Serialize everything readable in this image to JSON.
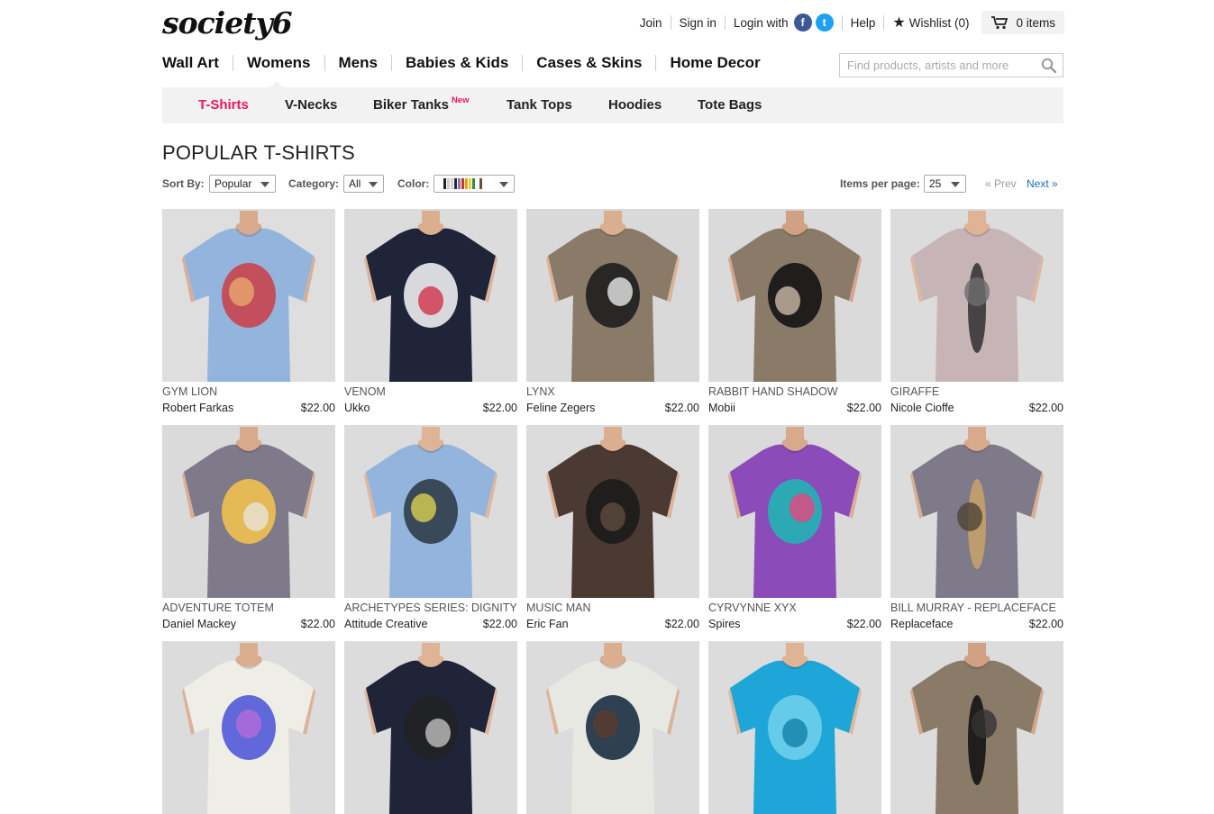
{
  "brand": {
    "logo": "society6"
  },
  "top_links": {
    "join": "Join",
    "sign_in": "Sign in",
    "login_with": "Login with",
    "facebook_glyph": "f",
    "twitter_glyph": "t",
    "help": "Help",
    "wishlist": "Wishlist (0)",
    "cart": "0 items"
  },
  "main_nav": [
    "Wall Art",
    "Womens",
    "Mens",
    "Babies & Kids",
    "Cases & Skins",
    "Home Decor"
  ],
  "search": {
    "placeholder": "Find products, artists and more"
  },
  "sub_nav": {
    "items": [
      "T-Shirts",
      "V-Necks",
      "Biker Tanks",
      "Tank Tops",
      "Hoodies",
      "Tote Bags"
    ],
    "active": "T-Shirts",
    "new_badge": "New"
  },
  "page_title": "POPULAR T-SHIRTS",
  "filters": {
    "sort_by_label": "Sort By:",
    "sort_by_value": "Popular",
    "category_label": "Category:",
    "category_value": "All",
    "color_label": "Color:",
    "color_swatches": [
      "#ffffff",
      "#222222",
      "#cfcfcf",
      "#e0c9c9",
      "#1c2a4e",
      "#8d6fb2",
      "#c0392b",
      "#f39c12",
      "#e8d43a",
      "#2e8b57",
      "#ffffff",
      "#6b4e3d"
    ],
    "items_per_page_label": "Items per page:",
    "items_per_page_value": "25",
    "prev": "« Prev",
    "next": "Next »"
  },
  "colors": {
    "accent_pink": "#e8175d",
    "link_blue": "#1a6fb5"
  },
  "products": [
    {
      "title": "GYM LION",
      "artist": "Robert Farkas",
      "price": "$22.00",
      "shirt": "#93b4dc",
      "bg": "#dedede",
      "skin": "#d8a98b",
      "art": "#c9414b",
      "art2": "#e7a86b"
    },
    {
      "title": "VENOM",
      "artist": "Ukko",
      "price": "$22.00",
      "shirt": "#1f2438",
      "bg": "#dcdcdc",
      "skin": "#dcae90",
      "art": "#f3f3f3",
      "art2": "#d2324a"
    },
    {
      "title": "LYNX",
      "artist": "Feline Zegers",
      "price": "$22.00",
      "shirt": "#8a7a68",
      "bg": "#d9d9d9",
      "skin": "#dcae90",
      "art": "#1b1b1b",
      "art2": "#e8e8e8"
    },
    {
      "title": "RABBIT HAND SHADOW",
      "artist": "Mobii",
      "price": "$22.00",
      "shirt": "#8a7a68",
      "bg": "#dadada",
      "skin": "#d2a184",
      "art": "#111111",
      "art2": "#c9b9a6"
    },
    {
      "title": "GIRAFFE",
      "artist": "Nicole Cioffe",
      "price": "$22.00",
      "shirt": "#c7b4b6",
      "bg": "#dcdcdc",
      "skin": "#dfb396",
      "art": "#333333",
      "art2": "#6e6e6e"
    },
    {
      "title": "ADVENTURE TOTEM",
      "artist": "Daniel Mackey",
      "price": "$22.00",
      "shirt": "#7e7a8a",
      "bg": "#dadada",
      "skin": "#d8a98b",
      "art": "#f2c14f",
      "art2": "#e9e3d8"
    },
    {
      "title": "ARCHETYPES SERIES: DIGNITY",
      "artist": "Attitude Creative",
      "price": "$22.00",
      "shirt": "#93b4dc",
      "bg": "#dcdcdc",
      "skin": "#dfb396",
      "art": "#2d3a44",
      "art2": "#d9d14f"
    },
    {
      "title": "MUSIC MAN",
      "artist": "Eric Fan",
      "price": "$22.00",
      "shirt": "#4a3a32",
      "bg": "#dcdcdc",
      "skin": "#dcae90",
      "art": "#1a1a1a",
      "art2": "#5e4a3f"
    },
    {
      "title": "CYRVYNNE XYX",
      "artist": "Spires",
      "price": "$22.00",
      "shirt": "#8b4bb8",
      "bg": "#dadada",
      "skin": "#d8a98b",
      "art": "#1fb6b3",
      "art2": "#e8457d"
    },
    {
      "title": "BILL MURRAY - REPLACEFACE",
      "artist": "Replaceface",
      "price": "$22.00",
      "shirt": "#7e7a8a",
      "bg": "#dcdcdc",
      "skin": "#d8a98b",
      "art": "#c6a06a",
      "art2": "#4e4534"
    },
    {
      "title": "",
      "artist": "",
      "price": "",
      "shirt": "#efeee6",
      "bg": "#dcdcdc",
      "skin": "#dcae90",
      "art": "#4c55d8",
      "art2": "#b46bd9"
    },
    {
      "title": "",
      "artist": "",
      "price": "",
      "shirt": "#1f2438",
      "bg": "#dcdcdc",
      "skin": "#dfb396",
      "art": "#222222",
      "art2": "#c0c0c0"
    },
    {
      "title": "",
      "artist": "",
      "price": "",
      "shirt": "#e8e8e2",
      "bg": "#dcdcdc",
      "skin": "#dcae90",
      "art": "#14283f",
      "art2": "#5b3a2a"
    },
    {
      "title": "",
      "artist": "",
      "price": "",
      "shirt": "#1fa6d8",
      "bg": "#dcdcdc",
      "skin": "#dfb396",
      "art": "#6fd0ea",
      "art2": "#147fa6"
    },
    {
      "title": "",
      "artist": "",
      "price": "",
      "shirt": "#8a7a68",
      "bg": "#dcdcdc",
      "skin": "#d2a184",
      "art": "#111111",
      "art2": "#333333"
    }
  ]
}
